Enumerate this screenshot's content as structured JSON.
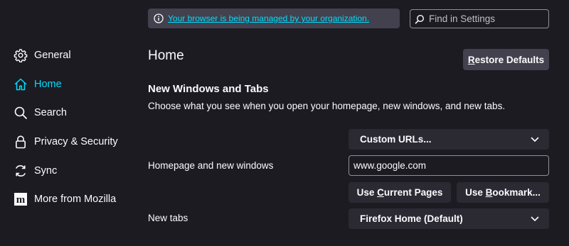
{
  "notice": {
    "text": "Your browser is being managed by your organization."
  },
  "search": {
    "placeholder": "Find in Settings",
    "value": ""
  },
  "sidebar": {
    "items": [
      {
        "label": "General",
        "icon": "gear-icon",
        "active": false
      },
      {
        "label": "Home",
        "icon": "home-icon",
        "active": true
      },
      {
        "label": "Search",
        "icon": "search-icon",
        "active": false
      },
      {
        "label": "Privacy & Security",
        "icon": "lock-icon",
        "active": false
      },
      {
        "label": "Sync",
        "icon": "sync-icon",
        "active": false
      },
      {
        "label": "More from Mozilla",
        "icon": "mozilla-logo-icon",
        "active": false
      }
    ]
  },
  "main": {
    "title": "Home",
    "restore_label_accel": "R",
    "restore_label_rest": "estore Defaults",
    "section_title": "New Windows and Tabs",
    "section_desc": "Choose what you see when you open your homepage, new windows, and new tabs.",
    "homepage": {
      "label": "Homepage and new windows",
      "select_value": "Custom URLs...",
      "url_value": "www.google.com",
      "use_current_pre": "Use ",
      "use_current_accel": "C",
      "use_current_post": "urrent Pages",
      "use_bookmark_pre": "Use ",
      "use_bookmark_accel": "B",
      "use_bookmark_post": "ookmark..."
    },
    "newtabs": {
      "label": "New tabs",
      "select_value": "Firefox Home (Default)"
    }
  },
  "colors": {
    "accent": "#00ddff",
    "background": "#1c1b22",
    "control": "#2b2a33"
  }
}
